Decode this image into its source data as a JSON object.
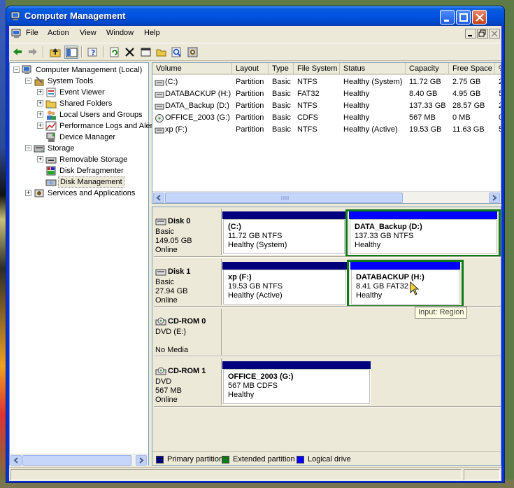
{
  "window": {
    "title": "Computer Management"
  },
  "menu": [
    "File",
    "Action",
    "View",
    "Window",
    "Help"
  ],
  "tree": {
    "items": [
      {
        "label": "Computer Management (Local)",
        "level": 0,
        "expander": "−",
        "icon": "computer-icon"
      },
      {
        "label": "System Tools",
        "level": 1,
        "expander": "−",
        "icon": "tools-icon"
      },
      {
        "label": "Event Viewer",
        "level": 2,
        "expander": "+",
        "icon": "event-viewer-icon"
      },
      {
        "label": "Shared Folders",
        "level": 2,
        "expander": "+",
        "icon": "shared-folder-icon"
      },
      {
        "label": "Local Users and Groups",
        "level": 2,
        "expander": "+",
        "icon": "users-icon"
      },
      {
        "label": "Performance Logs and Alerts",
        "level": 2,
        "expander": "+",
        "icon": "performance-icon"
      },
      {
        "label": "Device Manager",
        "level": 2,
        "expander": "",
        "icon": "device-manager-icon"
      },
      {
        "label": "Storage",
        "level": 1,
        "expander": "−",
        "icon": "storage-icon"
      },
      {
        "label": "Removable Storage",
        "level": 2,
        "expander": "+",
        "icon": "removable-storage-icon"
      },
      {
        "label": "Disk Defragmenter",
        "level": 2,
        "expander": "",
        "icon": "defrag-icon"
      },
      {
        "label": "Disk Management",
        "level": 2,
        "expander": "",
        "icon": "disk-management-icon",
        "selected": true
      },
      {
        "label": "Services and Applications",
        "level": 1,
        "expander": "+",
        "icon": "services-icon"
      }
    ]
  },
  "volumes": {
    "columns": [
      "Volume",
      "Layout",
      "Type",
      "File System",
      "Status",
      "Capacity",
      "Free Space",
      "%"
    ],
    "rows": [
      [
        "(C:)",
        "Partition",
        "Basic",
        "NTFS",
        "Healthy (System)",
        "11.72 GB",
        "2.75 GB",
        "2"
      ],
      [
        "DATABACKUP (H:)",
        "Partition",
        "Basic",
        "FAT32",
        "Healthy",
        "8.40 GB",
        "4.95 GB",
        "5"
      ],
      [
        "DATA_Backup (D:)",
        "Partition",
        "Basic",
        "NTFS",
        "Healthy",
        "137.33 GB",
        "28.57 GB",
        "2"
      ],
      [
        "OFFICE_2003 (G:)",
        "Partition",
        "Basic",
        "CDFS",
        "Healthy",
        "567 MB",
        "0 MB",
        "0"
      ],
      [
        "xp (F:)",
        "Partition",
        "Basic",
        "NTFS",
        "Healthy (Active)",
        "19.53 GB",
        "11.63 GB",
        "5"
      ]
    ]
  },
  "disks": [
    {
      "name": "Disk 0",
      "type": "Basic",
      "size": "149.05 GB",
      "status": "Online",
      "partitions": [
        {
          "name": "(C:)",
          "detail": "11.72 GB NTFS",
          "status": "Healthy (System)",
          "kind": "primary"
        },
        {
          "name": "DATA_Backup  (D:)",
          "detail": "137.33 GB NTFS",
          "status": "Healthy",
          "kind": "logical"
        }
      ]
    },
    {
      "name": "Disk 1",
      "type": "Basic",
      "size": "27.94 GB",
      "status": "Online",
      "partitions": [
        {
          "name": "xp  (F:)",
          "detail": "19.53 GB NTFS",
          "status": "Healthy (Active)",
          "kind": "primary"
        },
        {
          "name": "DATABACKUP  (H:)",
          "detail": "8.41 GB FAT32",
          "status": "Healthy",
          "kind": "logical"
        }
      ]
    },
    {
      "name": "CD-ROM 0",
      "type": "DVD (E:)",
      "size": "",
      "status": "No Media",
      "partitions": []
    },
    {
      "name": "CD-ROM 1",
      "type": "DVD",
      "size": "567 MB",
      "status": "Online",
      "partitions": [
        {
          "name": "OFFICE_2003  (G:)",
          "detail": "567 MB CDFS",
          "status": "Healthy",
          "kind": "primary"
        }
      ]
    }
  ],
  "legend": [
    {
      "label": "Primary partition",
      "color": "#00007e"
    },
    {
      "label": "Extended partition",
      "color": "#0f7a18"
    },
    {
      "label": "Logical drive",
      "color": "#0000ff"
    }
  ],
  "tooltip": "Input: Region",
  "colors": {
    "primary": "#00007e",
    "logical": "#0000ff",
    "extended": "#0f7a18"
  }
}
